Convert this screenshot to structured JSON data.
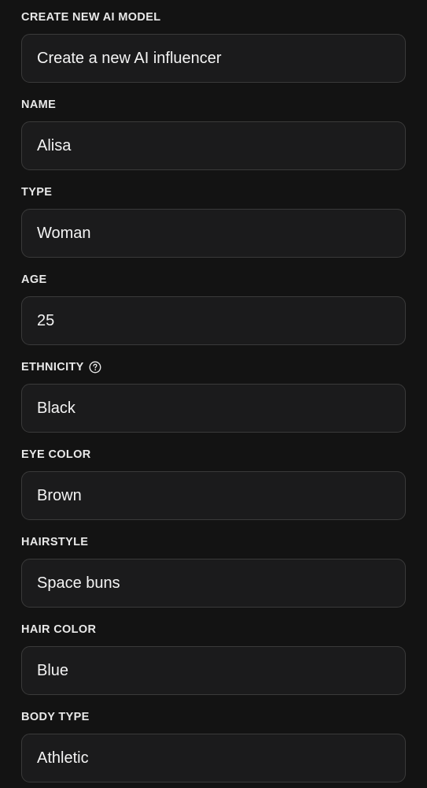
{
  "form": {
    "fields": [
      {
        "key": "create",
        "label": "CREATE NEW AI MODEL",
        "value": "Create a new AI influencer"
      },
      {
        "key": "name",
        "label": "NAME",
        "value": "Alisa"
      },
      {
        "key": "type",
        "label": "TYPE",
        "value": "Woman"
      },
      {
        "key": "age",
        "label": "AGE",
        "value": "25"
      },
      {
        "key": "ethnicity",
        "label": "ETHNICITY",
        "value": "Black",
        "icon": "help-circle-icon"
      },
      {
        "key": "eye_color",
        "label": "EYE COLOR",
        "value": "Brown"
      },
      {
        "key": "hairstyle",
        "label": "HAIRSTYLE",
        "value": "Space buns"
      },
      {
        "key": "hair_color",
        "label": "HAIR COLOR",
        "value": "Blue"
      },
      {
        "key": "body_type",
        "label": "BODY TYPE",
        "value": "Athletic"
      }
    ]
  },
  "colors": {
    "background": "#131313",
    "input_background": "#1b1b1c",
    "input_border": "#3a3a3a",
    "label_text": "#e9e9e9",
    "value_text": "#f4f4f4"
  }
}
